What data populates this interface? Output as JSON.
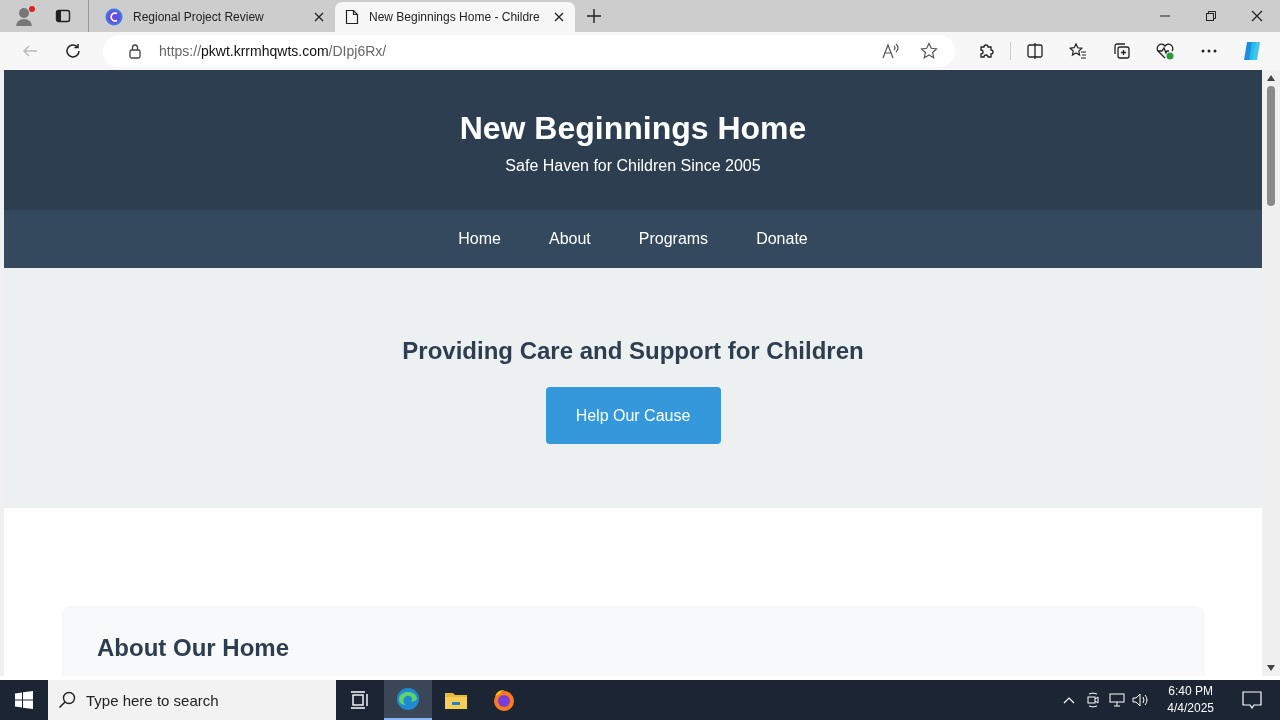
{
  "browser": {
    "tabs": [
      {
        "title": "Regional Project Review",
        "selected": false
      },
      {
        "title": "New Beginnings Home - Childre",
        "selected": true
      }
    ],
    "address": {
      "host": "pkwt.krrmhqwts.com",
      "prefix": "https://",
      "path": "/DIpj6Rx/"
    }
  },
  "site": {
    "title": "New Beginnings Home",
    "tagline": "Safe Haven for Children Since 2005",
    "nav": [
      "Home",
      "About",
      "Programs",
      "Donate"
    ],
    "hero": {
      "heading": "Providing Care and Support for Children",
      "button": "Help Our Cause"
    },
    "about": {
      "heading": "About Our Home"
    }
  },
  "taskbar": {
    "search": {
      "placeholder": "Type here to search"
    },
    "time": "6:40 PM",
    "date": "4/4/2025"
  }
}
